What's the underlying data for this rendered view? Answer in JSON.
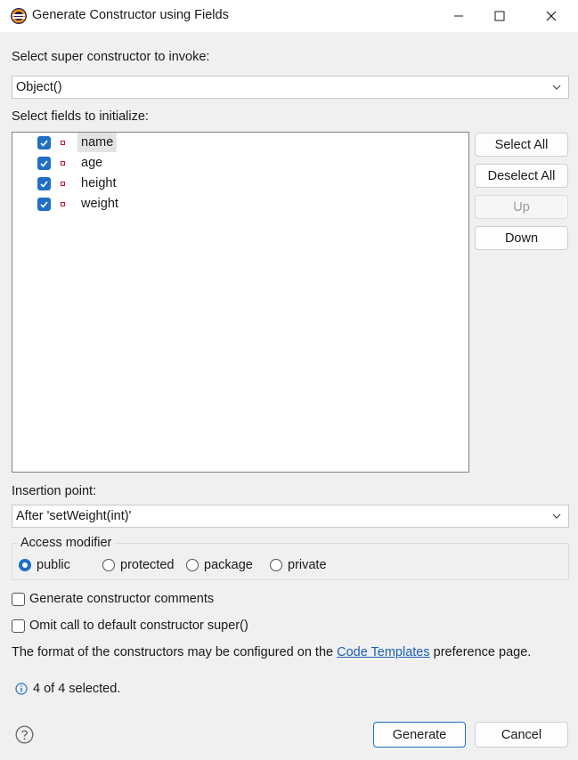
{
  "window": {
    "title": "Generate Constructor using Fields",
    "controls": {
      "minimize": "minimize-icon",
      "maximize": "maximize-icon",
      "close": "close-icon"
    }
  },
  "super_constructor": {
    "label": "Select super constructor to invoke:",
    "value": "Object()"
  },
  "fields": {
    "label": "Select fields to initialize:",
    "items": [
      {
        "name": "name",
        "checked": true,
        "selected": true
      },
      {
        "name": "age",
        "checked": true,
        "selected": false
      },
      {
        "name": "height",
        "checked": true,
        "selected": false
      },
      {
        "name": "weight",
        "checked": true,
        "selected": false
      }
    ]
  },
  "side_buttons": {
    "select_all": "Select All",
    "deselect_all": "Deselect All",
    "up": "Up",
    "down": "Down"
  },
  "insertion_point": {
    "label": "Insertion point:",
    "value": "After 'setWeight(int)'"
  },
  "access_modifier": {
    "label": "Access modifier",
    "options": [
      "public",
      "protected",
      "package",
      "private"
    ],
    "selected": "public"
  },
  "options": {
    "comments": "Generate constructor comments",
    "omit_super": "Omit call to default constructor super()"
  },
  "info": {
    "format_prefix": "The format of the constructors may be configured on the ",
    "link": "Code Templates",
    "format_suffix": " preference page.",
    "status": "4 of 4 selected."
  },
  "footer": {
    "generate": "Generate",
    "cancel": "Cancel"
  },
  "colors": {
    "accent": "#1f6fc5",
    "field_icon": "#c8102e"
  }
}
